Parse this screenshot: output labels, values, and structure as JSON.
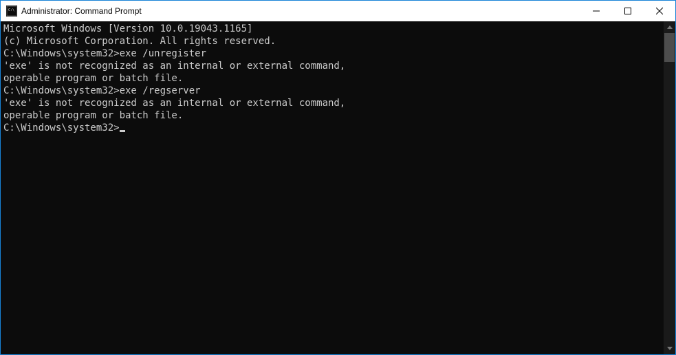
{
  "titlebar": {
    "title": "Administrator: Command Prompt"
  },
  "console": {
    "header_line_1": "Microsoft Windows [Version 10.0.19043.1165]",
    "header_line_2": "(c) Microsoft Corporation. All rights reserved.",
    "blank": "",
    "prompt_1": "C:\\Windows\\system32>",
    "cmd_1": "exe /unregister",
    "err_1a": "'exe' is not recognized as an internal or external command,",
    "err_1b": "operable program or batch file.",
    "prompt_2": "C:\\Windows\\system32>",
    "cmd_2": "exe /regserver",
    "err_2a": "'exe' is not recognized as an internal or external command,",
    "err_2b": "operable program or batch file.",
    "prompt_3": "C:\\Windows\\system32>"
  }
}
